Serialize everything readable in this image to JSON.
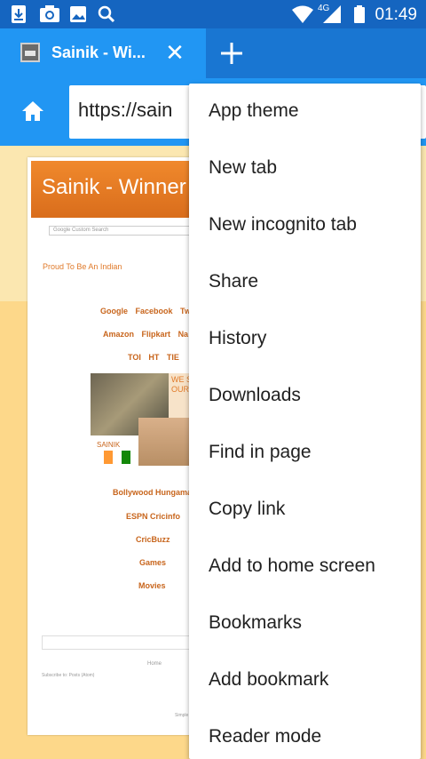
{
  "status_bar": {
    "left_icons": [
      "download-icon",
      "camera-icon",
      "image-icon",
      "search-icon"
    ],
    "network": "4G",
    "time": "01:49"
  },
  "tab": {
    "title": "Sainik - Wi...",
    "close_glyph": "✕"
  },
  "url_bar": {
    "url": "https://sain"
  },
  "site": {
    "title": "Sainik - Winner",
    "search_placeholder": "Google Custom Search",
    "tagline": "Proud To Be An Indian",
    "links_row1": [
      "Google",
      "Facebook",
      "Tw"
    ],
    "links_row2": [
      "Amazon",
      "Flipkart",
      "Na"
    ],
    "links_row3": [
      "TOI",
      "HT",
      "TIE"
    ],
    "hero_text": "WE SAL OUR",
    "hero_badge": "SAINIK",
    "side_links": [
      "Bollywood Hungama",
      "ESPN Cricinfo",
      "CricBuzz",
      "Games",
      "Movies"
    ],
    "footer_home": "Home",
    "footer_subscribe": "Subscribe to: Posts (Atom)",
    "footer_simple": "Simple"
  },
  "menu": {
    "items": [
      "App theme",
      "New tab",
      "New incognito tab",
      "Share",
      "History",
      "Downloads",
      "Find in page",
      "Copy link",
      "Add to home screen",
      "Bookmarks",
      "Add bookmark",
      "Reader mode"
    ]
  },
  "colors": {
    "status_bar": "#1565c0",
    "toolbar": "#2196f3",
    "page_background": "#fbe7b0",
    "site_header": "#e57a24"
  }
}
